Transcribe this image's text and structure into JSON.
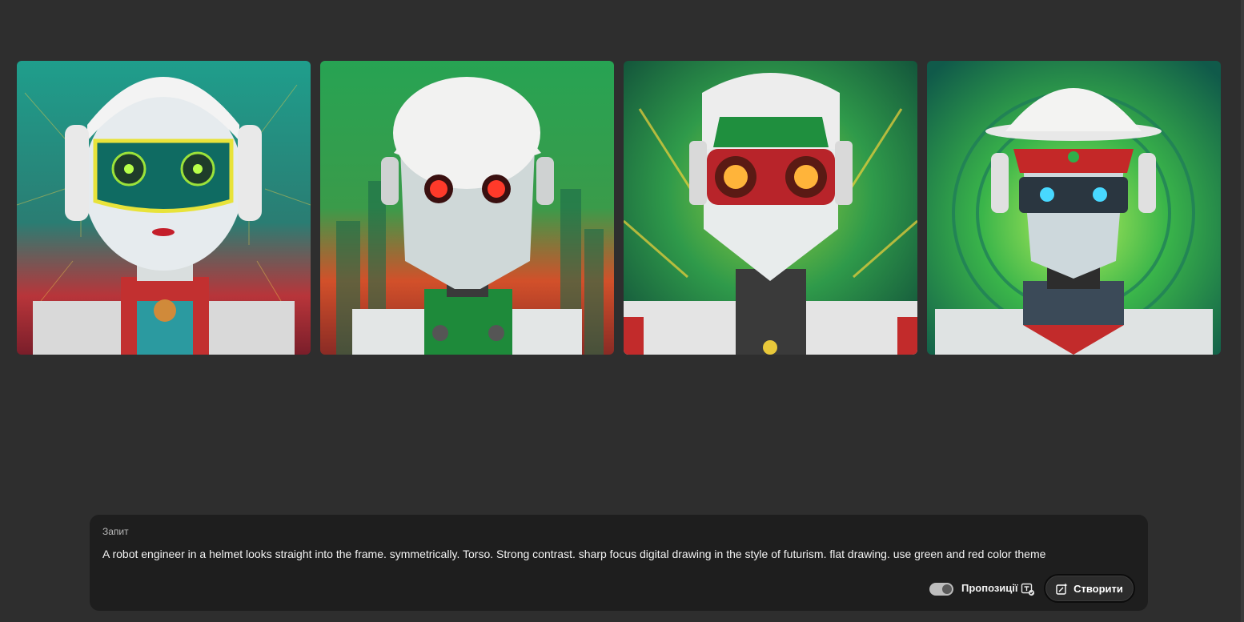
{
  "gallery": {
    "images": [
      {
        "name": "robot-image-1",
        "icon": "robot-portrait-teal-visor"
      },
      {
        "name": "robot-image-2",
        "icon": "robot-portrait-red-eyes"
      },
      {
        "name": "robot-image-3",
        "icon": "robot-portrait-orange-goggles"
      },
      {
        "name": "robot-image-4",
        "icon": "robot-portrait-hardhat-blue-eyes"
      }
    ]
  },
  "prompt": {
    "label": "Запит",
    "text": "A robot engineer in a helmet looks straight into the frame. symmetrically. Torso. Strong contrast. sharp focus digital drawing in the style of futurism. flat drawing. use green and red color theme"
  },
  "controls": {
    "suggestions_label": "Пропозиції",
    "suggestions_on": true,
    "generate_label": "Створити",
    "generate_icon": "generate-sparkle-icon",
    "suggest_icon": "text-suggestion-icon"
  },
  "colors": {
    "background": "#2e2e2e",
    "panel": "#1e1e1e",
    "accent_green": "#2fa84f",
    "accent_red": "#d12a2a"
  }
}
